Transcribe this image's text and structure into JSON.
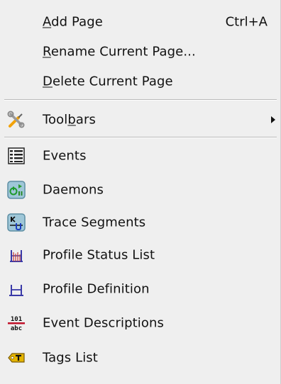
{
  "menu": {
    "add_page": {
      "prefix": "",
      "mnemonic": "A",
      "rest": "dd Page",
      "shortcut": "Ctrl+A"
    },
    "rename_page": {
      "prefix": "",
      "mnemonic": "R",
      "rest": "ename Current Page..."
    },
    "delete_page": {
      "prefix": "",
      "mnemonic": "D",
      "rest": "elete Current Page"
    },
    "toolbars": {
      "prefix": "Tool",
      "mnemonic": "b",
      "rest": "ars"
    },
    "events": {
      "label": "Events"
    },
    "daemons": {
      "label": "Daemons"
    },
    "trace_segments": {
      "label": "Trace Segments"
    },
    "profile_status_list": {
      "label": "Profile Status List"
    },
    "profile_definition": {
      "label": "Profile Definition"
    },
    "event_descriptions": {
      "label": "Event Descriptions"
    },
    "tags_list": {
      "label": "Tags List"
    }
  },
  "icons": {
    "toolbars": "tools-icon",
    "events": "events-list-icon",
    "daemons": "daemons-icon",
    "trace_segments": "trace-segments-icon",
    "profile_status_list": "profile-status-list-icon",
    "profile_definition": "profile-definition-icon",
    "event_descriptions": "event-descriptions-icon",
    "tags_list": "tags-list-icon"
  },
  "icon_glyphs": {
    "event_descriptions_top": "101",
    "event_descriptions_bottom": "abc"
  }
}
